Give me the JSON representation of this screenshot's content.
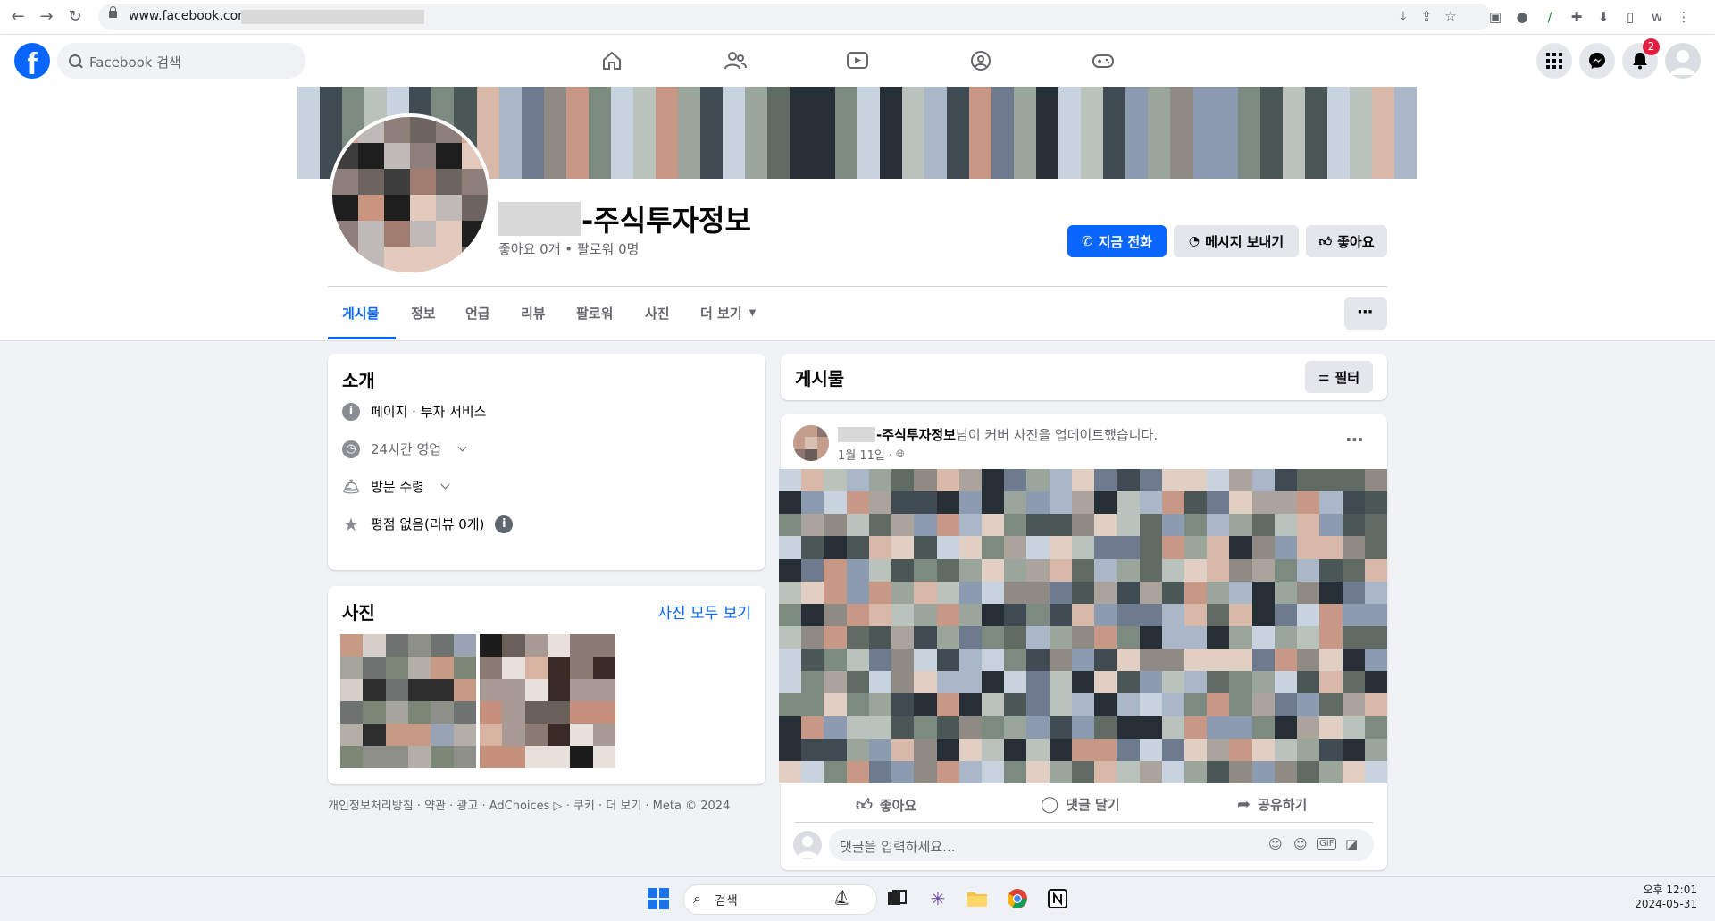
{
  "browser": {
    "url": "www.facebook.com/"
  },
  "header": {
    "search_placeholder": "Facebook 검색",
    "notification_count": "2"
  },
  "profile": {
    "name_suffix": "-주식투자정보",
    "stats": "좋아요 0개 • 팔로워 0명",
    "buttons": {
      "call": "지금 전화",
      "message": "메시지 보내기",
      "like": "좋아요"
    },
    "tabs": [
      "게시물",
      "정보",
      "언급",
      "리뷰",
      "팔로워",
      "사진",
      "더 보기"
    ]
  },
  "intro": {
    "title": "소개",
    "category": "페이지 · 투자 서비스",
    "hours": "24시간 영업",
    "service": "방문 수령",
    "rating": "평점 없음(리뷰 0개)"
  },
  "photos": {
    "title": "사진",
    "see_all": "사진 모두 보기"
  },
  "footer": "개인정보처리방침 · 약관 · 광고 · AdChoices ▷ · 쿠키 · 더 보기 · Meta © 2024",
  "posts": {
    "title": "게시물",
    "filter": "필터",
    "post": {
      "author": "-주식투자정보",
      "action_text": "님이 커버 사진을 업데이트했습니다.",
      "date": "1월 11일 ·",
      "actions": {
        "like": "좋아요",
        "comment": "댓글 달기",
        "share": "공유하기"
      },
      "comment_placeholder": "댓글을 입력하세요..."
    }
  },
  "taskbar": {
    "search": "검색",
    "time": "오후 12:01",
    "date": "2024-05-31"
  },
  "colors": {
    "fb_blue": "#0866ff",
    "page_bg": "#f0f2f5",
    "badge_red": "#e41e3f"
  }
}
